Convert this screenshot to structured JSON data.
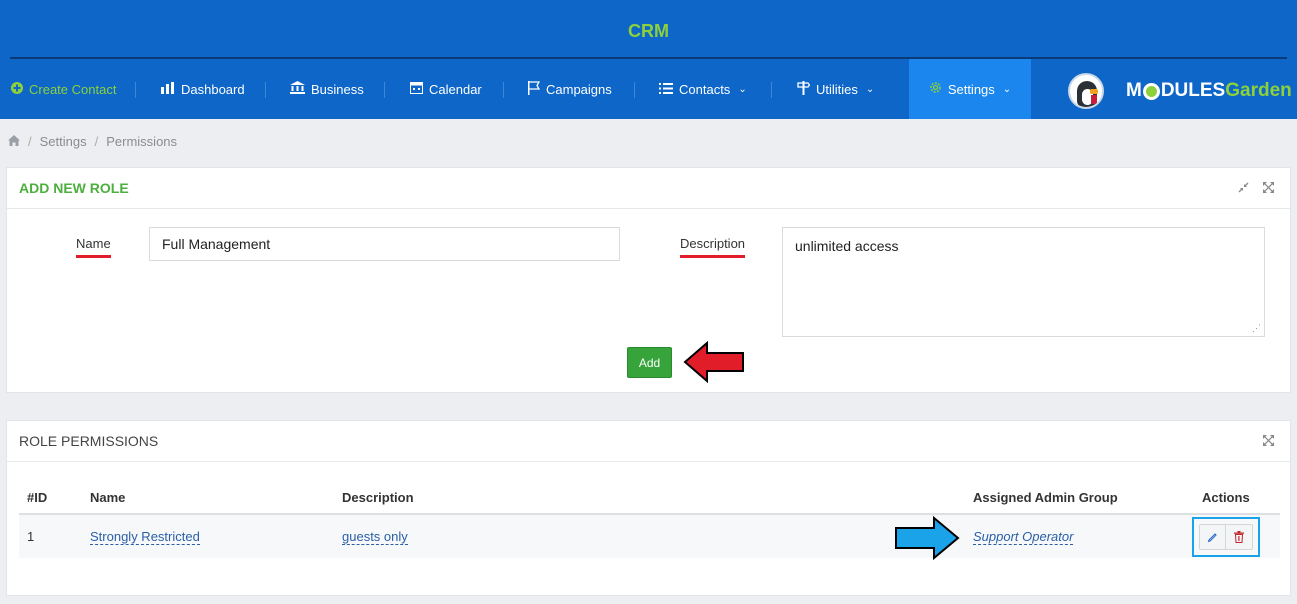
{
  "app": {
    "title": "CRM"
  },
  "nav": {
    "create_contact": "Create Contact",
    "dashboard": "Dashboard",
    "business": "Business",
    "calendar": "Calendar",
    "campaigns": "Campaigns",
    "contacts": "Contacts",
    "utilities": "Utilities",
    "settings": "Settings"
  },
  "brand": {
    "prefix": "M",
    "middle": "DULES",
    "suffix": "Garden"
  },
  "breadcrumb": {
    "items": [
      "Settings",
      "Permissions"
    ]
  },
  "add_role": {
    "title": "ADD NEW ROLE",
    "name_label": "Name",
    "name_value": "Full Management",
    "description_label": "Description",
    "description_value": "unlimited access",
    "add_button": "Add"
  },
  "role_permissions": {
    "title": "ROLE PERMISSIONS",
    "columns": [
      "#ID",
      "Name",
      "Description",
      "Assigned Admin Group",
      "Actions"
    ],
    "rows": [
      {
        "id": "1",
        "name": "Strongly Restricted",
        "description": "guests only",
        "admin_group": "Support Operator"
      }
    ]
  },
  "colors": {
    "header": "#0d66c8",
    "accent_green": "#8cd13c",
    "button_green": "#36a43a",
    "active_nav": "#1a86ee",
    "highlight_red": "#e21d2a",
    "highlight_blue": "#1aa3e8"
  }
}
